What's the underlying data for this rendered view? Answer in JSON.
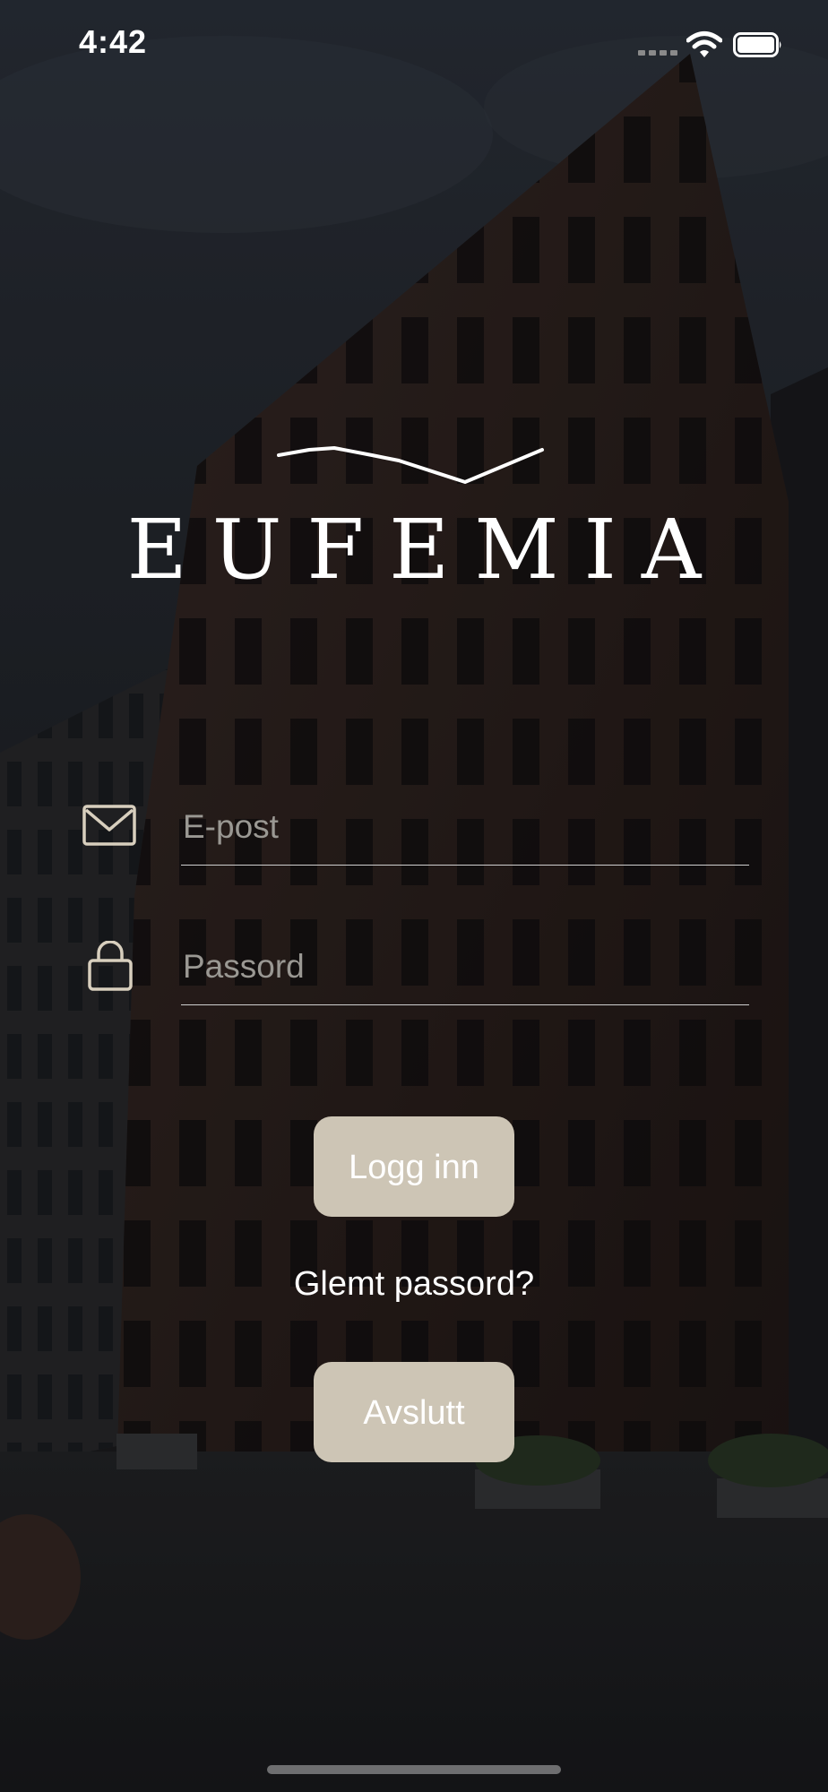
{
  "status_bar": {
    "time": "4:42",
    "signal_icon": "cellular-signal-icon",
    "wifi_icon": "wifi-icon",
    "battery_icon": "battery-full-icon"
  },
  "logo": {
    "text": "EUFEMIA",
    "mark_icon": "mountain-line-icon"
  },
  "login_form": {
    "email": {
      "icon": "envelope-icon",
      "placeholder": "E-post",
      "value": ""
    },
    "password": {
      "icon": "lock-icon",
      "placeholder": "Passord",
      "value": ""
    },
    "login_label": "Logg inn",
    "forgot_label": "Glemt passord?",
    "exit_label": "Avslutt"
  },
  "colors": {
    "button_bg": "#cdc5b5",
    "icon_stroke": "#d8cfbe",
    "text": "#ffffff",
    "placeholder": "#9a9893"
  }
}
